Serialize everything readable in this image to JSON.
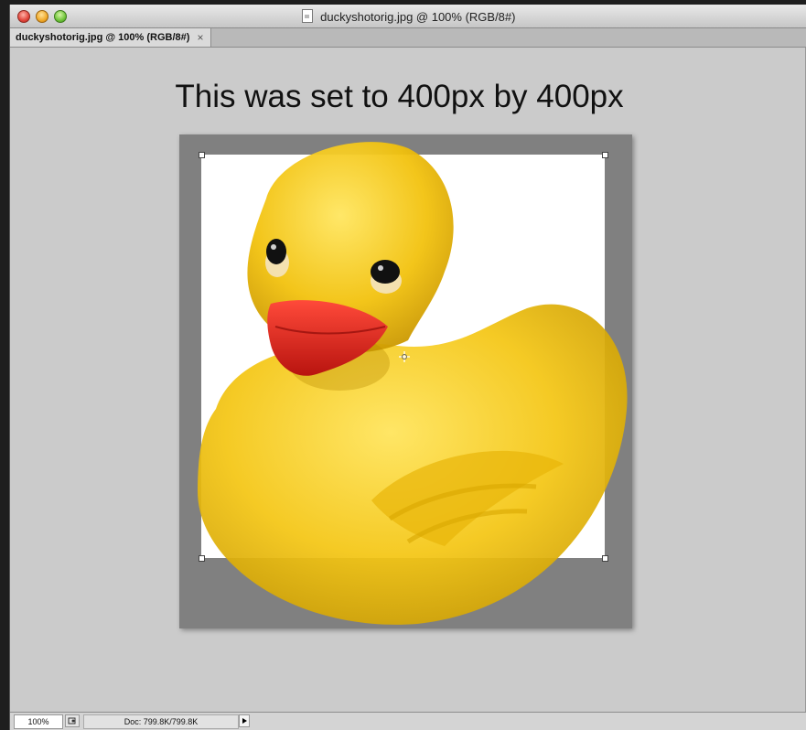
{
  "window": {
    "title": "duckyshotorig.jpg @ 100% (RGB/8#)",
    "tab_label": "duckyshotorig.jpg @ 100% (RGB/8#)",
    "tab_close": "×"
  },
  "canvas": {
    "heading": "This was set to 400px by 400px"
  },
  "status": {
    "zoom": "100%",
    "doc_size": "Doc: 799.8K/799.8K"
  },
  "colors": {
    "duck_body": "#f2c40f",
    "beak": "#d81b1b",
    "canvas_bg": "#cbcbcb",
    "frame_gray": "#808080"
  }
}
